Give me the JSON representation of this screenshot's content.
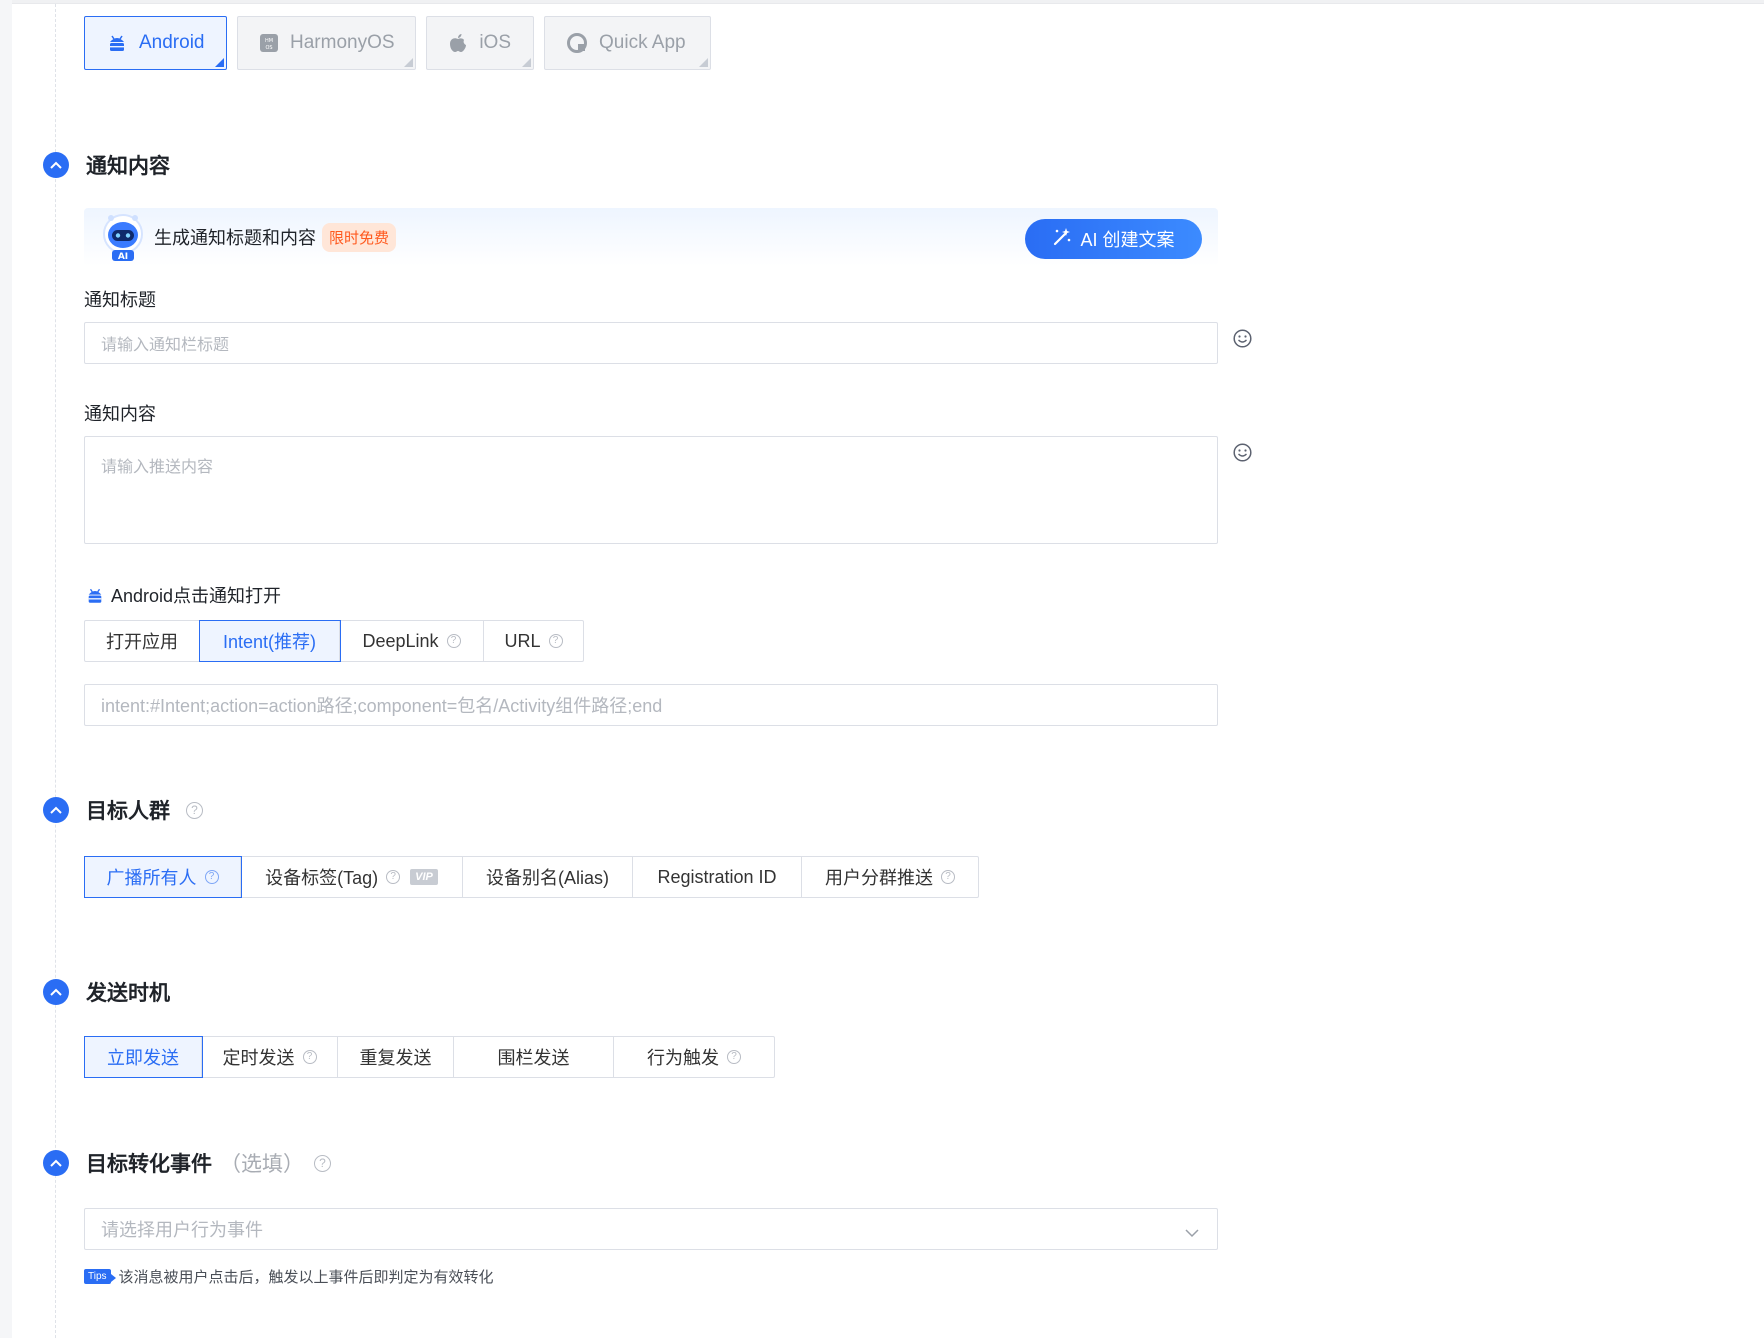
{
  "platforms": [
    {
      "label": "Android",
      "icon": "android-icon",
      "active": true
    },
    {
      "label": "HarmonyOS",
      "icon": "harmonyos-icon",
      "active": false
    },
    {
      "label": "iOS",
      "icon": "apple-icon",
      "active": false
    },
    {
      "label": "Quick App",
      "icon": "quick-app-icon",
      "active": false
    }
  ],
  "notification": {
    "section_title": "通知内容",
    "ai_banner": {
      "text": "生成通知标题和内容",
      "badge": "限时免费",
      "button_label": "AI 创建文案",
      "avatar_text": "AI"
    },
    "title_label": "通知标题",
    "title_placeholder": "请输入通知栏标题",
    "content_label": "通知内容",
    "content_placeholder": "请输入推送内容",
    "android_click_label": "Android点击通知打开",
    "open_modes": [
      "打开应用",
      "Intent(推荐)",
      "DeepLink",
      "URL"
    ],
    "open_mode_selected": "Intent(推荐)",
    "intent_placeholder": "intent:#Intent;action=action路径;component=包名/Activity组件路径;end"
  },
  "audience": {
    "section_title": "目标人群",
    "options": [
      "广播所有人",
      "设备标签(Tag)",
      "设备别名(Alias)",
      "Registration ID",
      "用户分群推送"
    ],
    "selected": "广播所有人",
    "vip_badge": "VIP"
  },
  "timing": {
    "section_title": "发送时机",
    "options": [
      "立即发送",
      "定时发送",
      "重复发送",
      "围栏发送",
      "行为触发"
    ],
    "selected": "立即发送"
  },
  "conversion": {
    "section_title": "目标转化事件",
    "optional_label": "（选填）",
    "select_placeholder": "请选择用户行为事件",
    "tips_badge": "Tips",
    "tips_text": "该消息被用户点击后，触发以上事件后即判定为有效转化"
  },
  "colors": {
    "primary": "#2a6df4",
    "badge_orange": "#ff5a1f",
    "border": "#dcdfe6"
  }
}
